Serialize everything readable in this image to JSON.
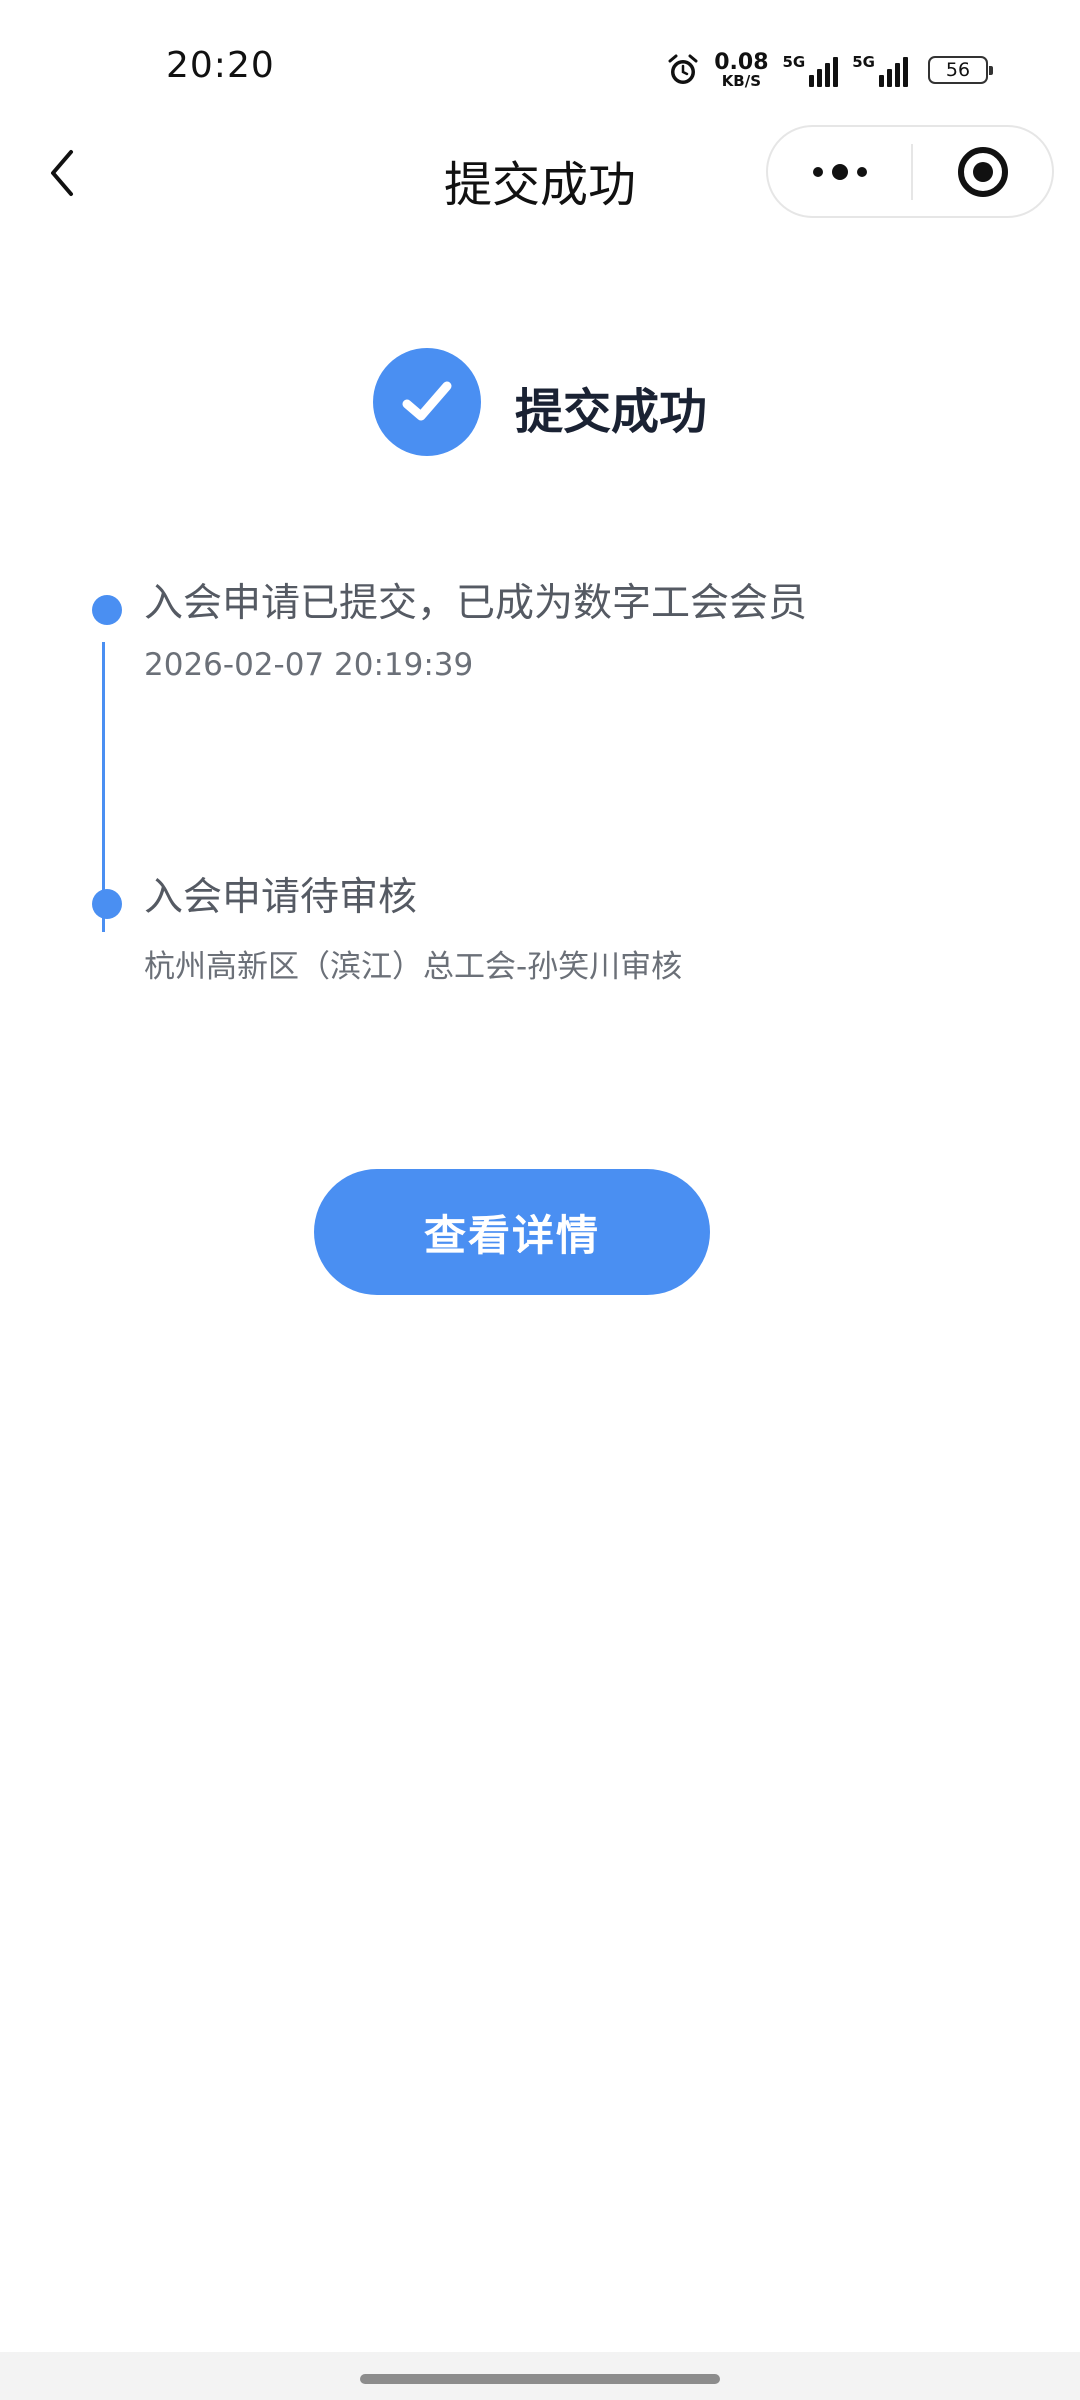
{
  "status_bar": {
    "time": "20:20",
    "net_speed_value": "0.08",
    "net_speed_unit": "KB/S",
    "sim1_label": "5G",
    "sim2_label": "5G",
    "battery_level": "56",
    "icons": [
      "alarm-icon",
      "signal-icon",
      "signal-icon",
      "battery-icon"
    ]
  },
  "nav": {
    "title": "提交成功",
    "back_icon": "chevron-left-icon",
    "more_icon": "more-dots-icon",
    "close_icon": "target-circle-icon"
  },
  "success": {
    "icon": "check-circle-icon",
    "text": "提交成功"
  },
  "timeline": [
    {
      "title": "入会申请已提交，已成为数字工会会员",
      "subtitle": "2026-02-07 20:19:39"
    },
    {
      "title": "入会申请待审核",
      "subtitle": "杭州高新区（滨江）总工会-孙笑川审核"
    }
  ],
  "actions": {
    "view_details_label": "查看详情"
  },
  "colors": {
    "accent": "#4a8ff2",
    "title_text": "#1a2233",
    "secondary_text": "#6b7078"
  }
}
